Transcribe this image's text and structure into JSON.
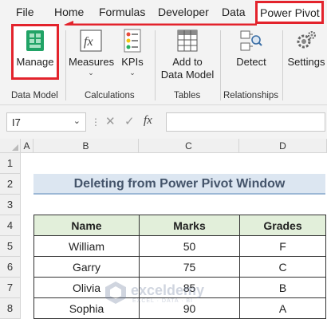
{
  "menu": {
    "items": [
      "File",
      "Home",
      "Formulas",
      "Developer",
      "Data"
    ],
    "active": "Power Pivot"
  },
  "ribbon": {
    "buttons": {
      "manage": "Manage",
      "measures": "Measures",
      "kpis": "KPIs",
      "add_to_data_model_line1": "Add to",
      "add_to_data_model_line2": "Data Model",
      "detect": "Detect",
      "settings": "Settings"
    },
    "groups": {
      "data_model": "Data Model",
      "calculations": "Calculations",
      "tables": "Tables",
      "relationships": "Relationships"
    }
  },
  "formula_bar": {
    "name_box": "I7",
    "fx_label": "fx",
    "formula": ""
  },
  "sheet": {
    "columns": [
      "A",
      "B",
      "C",
      "D"
    ],
    "rows": [
      "1",
      "2",
      "3",
      "4",
      "5",
      "6",
      "7",
      "8"
    ],
    "title": "Deleting from Power Pivot Window",
    "table_headers": [
      "Name",
      "Marks",
      "Grades"
    ],
    "table_rows": [
      [
        "William",
        "50",
        "F"
      ],
      [
        "Garry",
        "75",
        "C"
      ],
      [
        "Olivia",
        "85",
        "B"
      ],
      [
        "Sophia",
        "90",
        "A"
      ]
    ]
  },
  "watermark": {
    "name": "exceldemy",
    "tagline": "EXCEL · DATA · BI"
  },
  "colors": {
    "highlight": "#e3232c",
    "title_fill": "#dce6f1",
    "header_fill": "#e2efda",
    "excel_green": "#21a366"
  }
}
